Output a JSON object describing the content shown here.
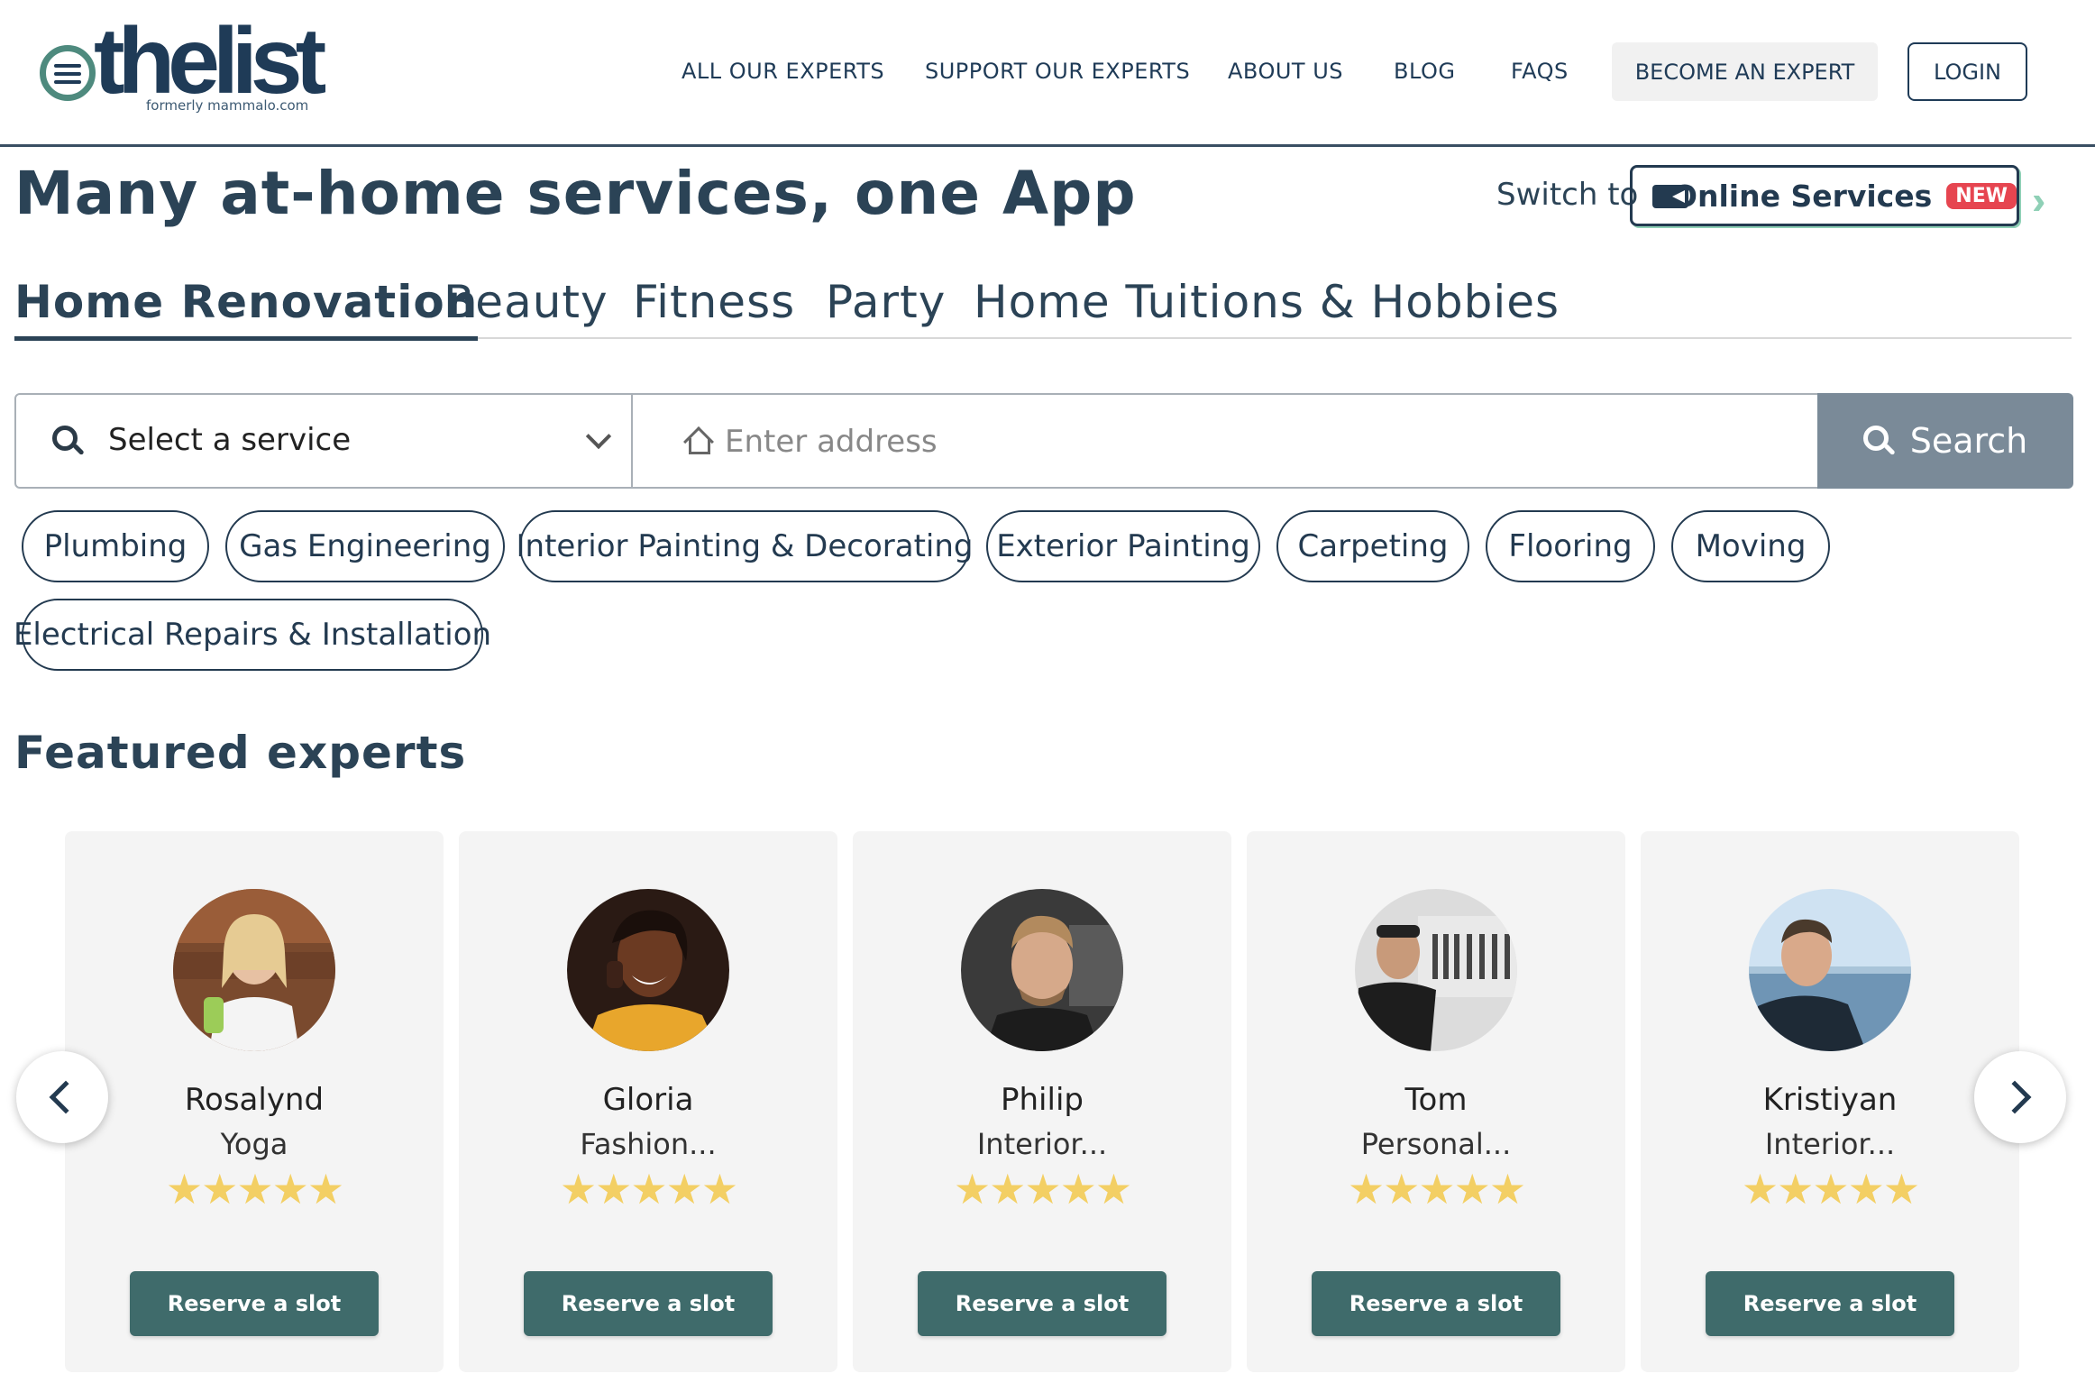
{
  "brand": {
    "logo_text": "thelist",
    "logo_sub": "formerly mammalo.com"
  },
  "nav": {
    "links": [
      "ALL OUR EXPERTS",
      "SUPPORT OUR EXPERTS",
      "ABOUT US",
      "BLOG",
      "FAQS"
    ],
    "become_expert": "BECOME AN EXPERT",
    "login": "LOGIN"
  },
  "hero": {
    "title": "Many at-home services, one App",
    "switch_to": "Switch to",
    "online_services": "Online Services",
    "new_badge": "NEW"
  },
  "tabs": [
    "Home Renovation",
    "Beauty",
    "Fitness",
    "Party",
    "Home Tuitions & Hobbies"
  ],
  "search": {
    "service_label": "Select a service",
    "address_placeholder": "Enter address",
    "button": "Search"
  },
  "chips": [
    "Plumbing",
    "Gas Engineering",
    "Interior Painting & Decorating",
    "Exterior Painting",
    "Carpeting",
    "Flooring",
    "Moving",
    "Electrical Repairs & Installation"
  ],
  "featured": {
    "title": "Featured experts",
    "experts": [
      {
        "name": "Rosalynd",
        "role": "Yoga",
        "stars": "★★★★★",
        "rating": 5,
        "cta": "Reserve a slot"
      },
      {
        "name": "Gloria",
        "role": "Fashion...",
        "stars": "★★★★★",
        "rating": 5,
        "cta": "Reserve a slot"
      },
      {
        "name": "Philip",
        "role": "Interior...",
        "stars": "★★★★★",
        "rating": 5,
        "cta": "Reserve a slot"
      },
      {
        "name": "Tom",
        "role": "Personal...",
        "stars": "★★★★★",
        "rating": 5,
        "cta": "Reserve a slot"
      },
      {
        "name": "Kristiyan",
        "role": "Interior...",
        "stars": "★★★★★",
        "rating": 5,
        "cta": "Reserve a slot"
      }
    ]
  },
  "colors": {
    "brand_navy": "#1f3b57",
    "brand_green": "#4e8a7e",
    "reserve_button": "#3f6b6b",
    "search_button": "#7a8a98",
    "star": "#f3cf64",
    "new_badge": "#e64550"
  },
  "icons": {
    "logo": "list-circle-icon",
    "online": "video-camera-icon",
    "switch_arrows": "double-chevron-right-icon",
    "service_search": "search-icon",
    "service_dropdown": "chevron-down-icon",
    "address": "house-icon",
    "carousel_prev": "chevron-left-icon",
    "carousel_next": "chevron-right-icon"
  }
}
